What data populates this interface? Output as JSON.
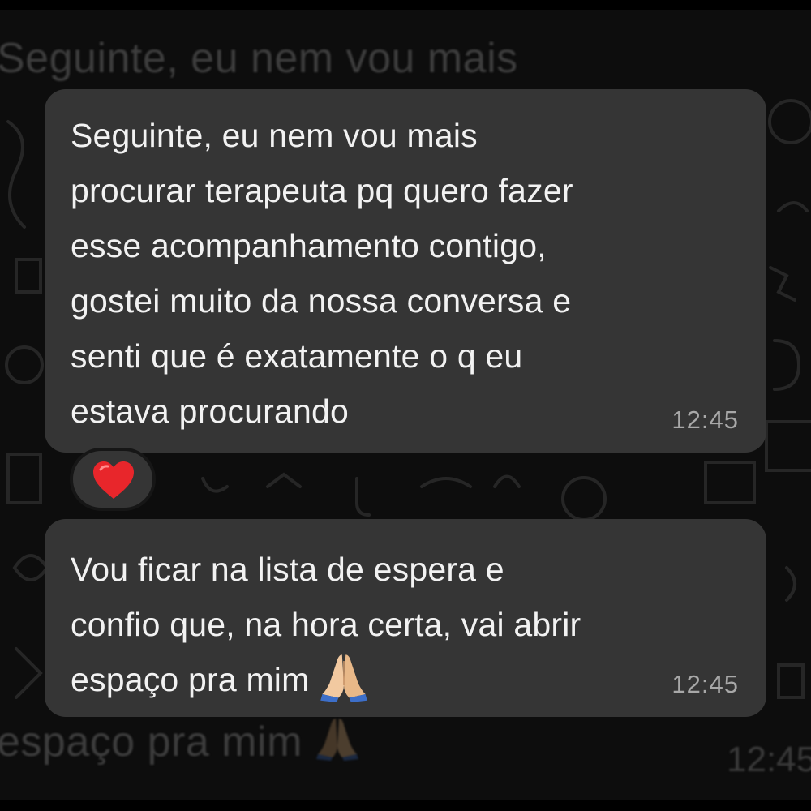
{
  "background": {
    "top_message_fragment": "Seguinte, eu nem vou mais",
    "bottom_message_fragment": "espaço pra mim",
    "bottom_time_fragment": "12:45"
  },
  "messages": [
    {
      "text": "Seguinte, eu nem vou mais\nprocurar terapeuta pq quero fazer\nesse acompanhamento contigo,\ngostei muito da nossa conversa e\nsenti que é exatamente o q eu\nestava procurando",
      "time": "12:45",
      "reaction": "heart"
    },
    {
      "text": "Vou ficar na lista de espera e\nconfio que, na hora certa, vai abrir\nespaço pra mim",
      "emoji": "folded-hands",
      "time": "12:45"
    }
  ],
  "colors": {
    "bubble": "#353535",
    "text": "#f2f2f2",
    "timestamp": "#a8a8a8",
    "heart": "#e8262b"
  }
}
